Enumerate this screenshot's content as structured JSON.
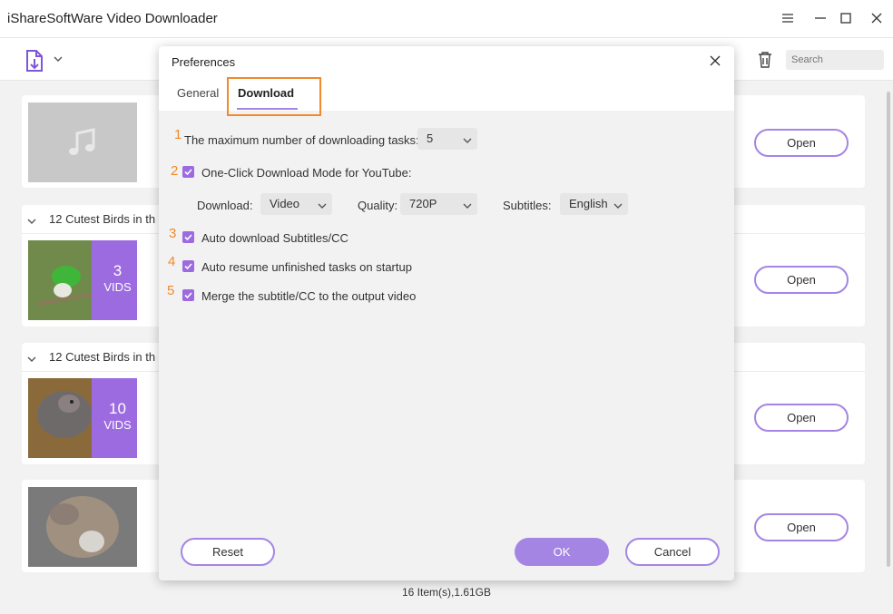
{
  "app": {
    "title": "iShareSoftWare Video Downloader",
    "status": "16 Item(s),1.61GB"
  },
  "toolbar": {
    "search_placeholder": "Search"
  },
  "list": {
    "groups": [
      {
        "title": "12 Cutest Birds in th",
        "count": "3",
        "count_label": "VIDS"
      },
      {
        "title": "12 Cutest Birds in th",
        "count": "10",
        "count_label": "VIDS"
      }
    ],
    "open_label": "Open"
  },
  "dialog": {
    "title": "Preferences",
    "tabs": [
      "General",
      "Download"
    ],
    "active_tab": "Download",
    "options": {
      "max_tasks_label": "The maximum number of downloading tasks:",
      "max_tasks_value": "5",
      "one_click_label": "One-Click Download Mode for YouTube:",
      "download_label": "Download:",
      "download_value": "Video",
      "quality_label": "Quality:",
      "quality_value": "720P",
      "subtitles_label": "Subtitles:",
      "subtitles_value": "English",
      "auto_subtitles_label": "Auto download Subtitles/CC",
      "auto_resume_label": "Auto resume unfinished tasks on startup",
      "merge_label": "Merge the subtitle/CC to the output video"
    },
    "steps": [
      "1",
      "2",
      "3",
      "4",
      "5"
    ],
    "buttons": {
      "reset": "Reset",
      "ok": "OK",
      "cancel": "Cancel"
    }
  },
  "colors": {
    "accent": "#a585e3",
    "badge": "#9d6be0",
    "annotation": "#f08a2c"
  }
}
